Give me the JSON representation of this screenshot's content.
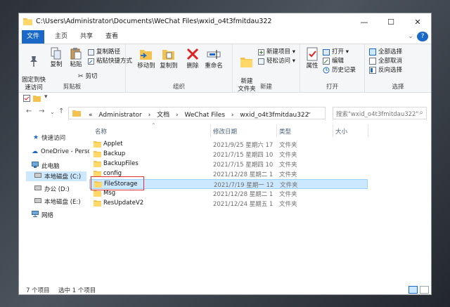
{
  "window": {
    "title": "C:\\Users\\Administrator\\Documents\\WeChat Files\\wxid_o4t3fmitdau322",
    "minimize": "—",
    "maximize": "☐",
    "close": "✕",
    "help": "?"
  },
  "ribbon_tabs": [
    {
      "label": "文件"
    },
    {
      "label": "主页"
    },
    {
      "label": "共享"
    },
    {
      "label": "查看"
    }
  ],
  "ribbon": {
    "clipboard": {
      "pin_label": "固定到快\n速访问",
      "copy_label": "复制",
      "paste_label": "粘贴",
      "copy_path": "复制路径",
      "paste_shortcut": "粘贴快捷方式",
      "cut": "剪切",
      "group": "剪贴板"
    },
    "organize": {
      "move_to": "移动到",
      "copy_to": "复制到",
      "delete": "删除",
      "rename": "重命名",
      "group": "组织"
    },
    "new": {
      "new_folder": "新建\n文件夹",
      "new_item": "新建项目 ▾",
      "easy_access": "轻松访问 ▾",
      "group": "新建"
    },
    "open": {
      "properties": "属性",
      "open": "打开 ▾",
      "edit": "编辑",
      "history": "历史记录",
      "group": "打开"
    },
    "select": {
      "select_all": "全部选择",
      "select_none": "全部取消",
      "invert": "反向选择",
      "group": "选择"
    }
  },
  "address": {
    "crumbs": [
      "«",
      "Administrator",
      "›",
      "文档",
      "›",
      "WeChat Files",
      "›",
      "wxid_o4t3fmitdau322"
    ],
    "dropdown": "⌄",
    "refresh": "↻"
  },
  "search": {
    "placeholder": "搜索\"wxid_o4t3fmitdau322\""
  },
  "nav_pane": [
    {
      "label": "快速访问",
      "icon": "star-icon"
    },
    {
      "label": "OneDrive - Perso",
      "icon": "cloud-icon"
    },
    {
      "label": "此电脑",
      "icon": "computer-icon"
    },
    {
      "label": "本地磁盘 (C:)",
      "icon": "drive-icon",
      "selected": true
    },
    {
      "label": "办公 (D:)",
      "icon": "drive-icon"
    },
    {
      "label": "本地磁盘 (E:)",
      "icon": "drive-icon"
    },
    {
      "label": "网络",
      "icon": "network-icon"
    }
  ],
  "columns": {
    "name": "名称",
    "date": "修改日期",
    "type": "类型",
    "size": "大小"
  },
  "files": [
    {
      "name": "Applet",
      "date": "2021/9/25 星期六 17:...",
      "type": "文件夹"
    },
    {
      "name": "Backup",
      "date": "2021/7/15 星期四 10:...",
      "type": "文件夹"
    },
    {
      "name": "BackupFiles",
      "date": "2021/7/15 星期四 10:...",
      "type": "文件夹"
    },
    {
      "name": "config",
      "date": "2021/12/28 星期二 1...",
      "type": "文件夹"
    },
    {
      "name": "FileStorage",
      "date": "2021/7/19 星期一 12:...",
      "type": "文件夹",
      "selected": true
    },
    {
      "name": "Msg",
      "date": "2021/12/28 星期二 1...",
      "type": "文件夹"
    },
    {
      "name": "ResUpdateV2",
      "date": "2021/12/24 星期五 1...",
      "type": "文件夹"
    }
  ],
  "status": {
    "count": "7 个项目",
    "selected": "选中 1 个项目"
  },
  "colors": {
    "accent": "#1a68c8",
    "folder": "#f4c34f",
    "selection": "#cce8ff",
    "highlight_box": "#e03030"
  }
}
